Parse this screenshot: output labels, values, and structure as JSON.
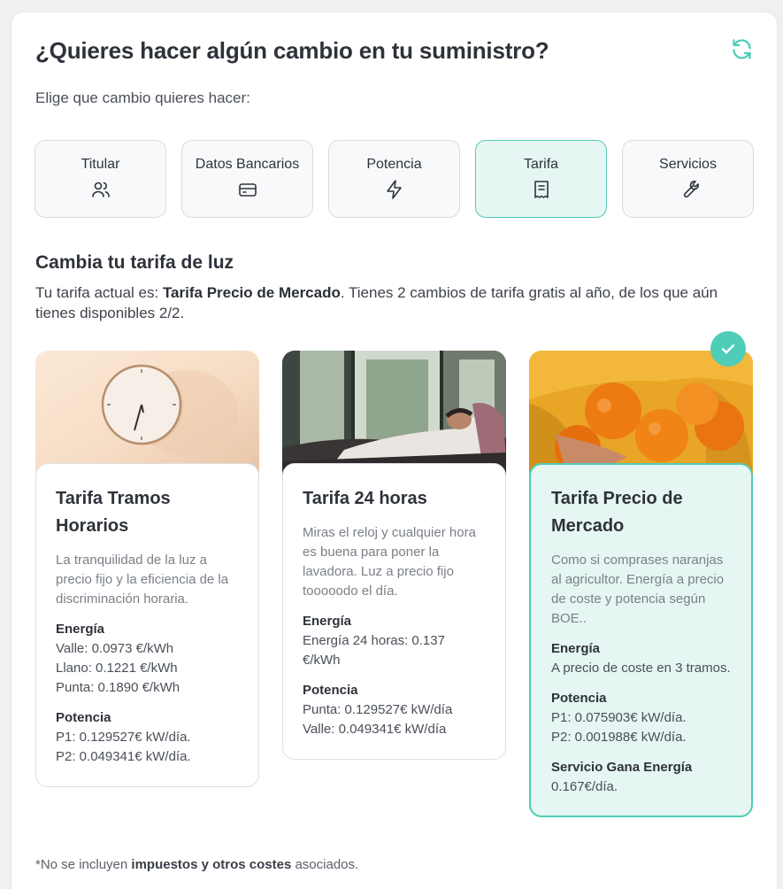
{
  "header": {
    "title": "¿Quieres hacer algún cambio en tu suministro?",
    "subtitle": "Elige que cambio quieres hacer:",
    "refresh_icon": "refresh-icon"
  },
  "options": [
    {
      "label": "Titular",
      "icon": "users-icon"
    },
    {
      "label": "Datos Bancarios",
      "icon": "credit-card-icon"
    },
    {
      "label": "Potencia",
      "icon": "lightning-icon"
    },
    {
      "label": "Tarifa",
      "icon": "receipt-icon",
      "active": true
    },
    {
      "label": "Servicios",
      "icon": "wrench-icon"
    }
  ],
  "section": {
    "title": "Cambia tu tarifa de luz",
    "current_prefix": "Tu tarifa actual es: ",
    "current_tariff": "Tarifa Precio de Mercado",
    "current_suffix": ". Tienes 2 cambios de tarifa gratis al año, de los que aún tienes disponibles 2/2."
  },
  "cards": [
    {
      "title": "Tarifa Tramos Horarios",
      "description": "La tranquilidad de la luz a precio fijo y la eficiencia de la discriminación horaria.",
      "energy_heading": "Energía",
      "energy_lines": [
        "Valle: 0.0973 €/kWh",
        "Llano: 0.1221 €/kWh",
        "Punta: 0.1890 €/kWh"
      ],
      "power_heading": "Potencia",
      "power_lines": [
        "P1: 0.129527€ kW/día.",
        "P2: 0.049341€ kW/día."
      ]
    },
    {
      "title": "Tarifa 24 horas",
      "description": "Miras el reloj y cualquier hora es buena para poner la lavadora. Luz a precio fijo tooooodo el día.",
      "energy_heading": "Energía",
      "energy_lines": [
        "Energía 24 horas: 0.137 €/kWh"
      ],
      "power_heading": "Potencia",
      "power_lines": [
        "Punta: 0.129527€ kW/día",
        "Valle: 0.049341€ kW/día"
      ]
    },
    {
      "title": "Tarifa Precio de Mercado",
      "description": "Como si comprases naranjas al agricultor. Energía a precio de coste y potencia según BOE..",
      "energy_heading": "Energía",
      "energy_lines": [
        "A precio de coste en 3 tramos."
      ],
      "power_heading": "Potencia",
      "power_lines": [
        "P1: 0.075903€ kW/día.",
        "P2: 0.001988€ kW/día."
      ],
      "service_heading": "Servicio Gana Energía",
      "service_lines": [
        "0.167€/día."
      ],
      "selected": true
    }
  ],
  "footnote": {
    "prefix": "*No se incluyen ",
    "bold": "impuestos y otros costes",
    "suffix": " asociados."
  },
  "colors": {
    "accent": "#4fcdb8",
    "accent_bg": "#e6f6f3",
    "text": "#2e323a"
  }
}
